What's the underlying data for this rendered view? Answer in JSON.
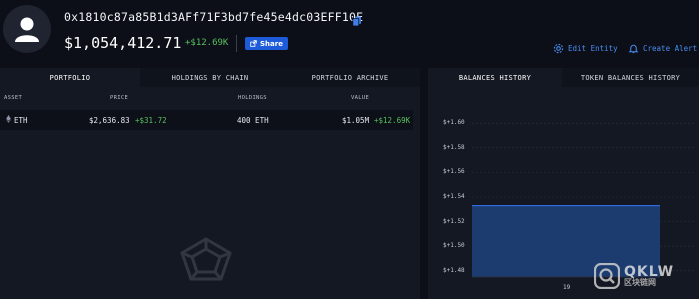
{
  "header": {
    "address": "0x1810c87a85B1d3AFf71F3bd7fe45e4dc03EFF10E",
    "balance": "$1,054,412.71",
    "balance_change": "+$12.69K",
    "share_label": "Share",
    "edit_entity_label": "Edit Entity",
    "create_alert_label": "Create Alert"
  },
  "portfolio": {
    "tabs": [
      "PORTFOLIO",
      "HOLDINGS BY CHAIN",
      "PORTFOLIO ARCHIVE"
    ],
    "columns": {
      "asset": "ASSET",
      "price": "PRICE",
      "holdings": "HOLDINGS",
      "value": "VALUE"
    },
    "rows": [
      {
        "asset": "ETH",
        "price": "$2,636.83",
        "price_change": "+$31.72",
        "holdings": "400 ETH",
        "value": "$1.05M",
        "value_change": "+$12.69K"
      }
    ]
  },
  "balances": {
    "tabs": [
      "BALANCES HISTORY",
      "TOKEN BALANCES HISTORY"
    ],
    "chart_data": {
      "type": "area",
      "y_tick_labels": [
        "$+1.60",
        "$+1.58",
        "$+1.56",
        "$+1.54",
        "$+1.52",
        "$+1.50",
        "$+1.48"
      ],
      "x_tick_labels": [
        "19"
      ],
      "series_level_tick": 1.533,
      "ylim": [
        1.475,
        1.605
      ],
      "series_color": "#1c3b6e",
      "line_color": "#2f6ad8"
    }
  },
  "watermark": {
    "big": "QKLW",
    "small": "区块链网"
  },
  "colors": {
    "accent": "#4a8df2",
    "positive": "#58c05f",
    "share": "#1e5bd8"
  }
}
